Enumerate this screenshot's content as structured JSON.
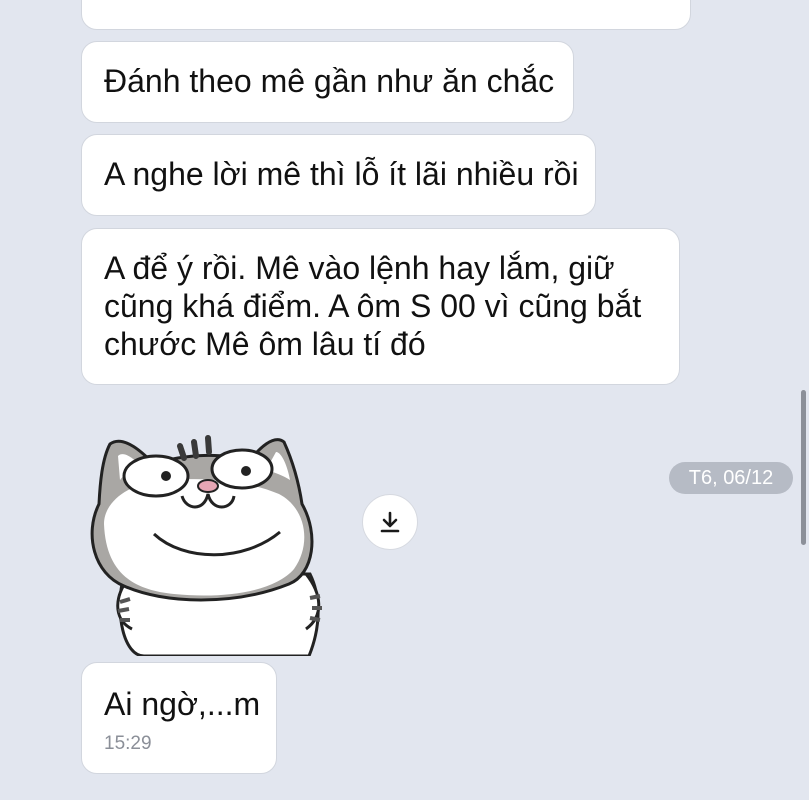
{
  "messages": {
    "m1": "Đánh theo mê gần như ăn chắc",
    "m2": "A nghe lời mê thì lỗ ít lãi nhiều rồi",
    "m3": [
      "A để ý rồi. Mê vào lệnh hay lắm, giữ",
      "cũng khá điểm. A ôm S 00 vì cũng bắt",
      "chước Mê ôm lâu tí đó"
    ],
    "m4": "Ai ngờ,...m",
    "m4_time": "15:29"
  },
  "date_separator": "T6, 06/12",
  "sticker": {
    "name": "cat-sticker"
  },
  "icons": {
    "download": "download-icon"
  },
  "colors": {
    "background": "#e2e6ef",
    "bubble": "#ffffff",
    "date_pill": "#b6bbc5"
  }
}
